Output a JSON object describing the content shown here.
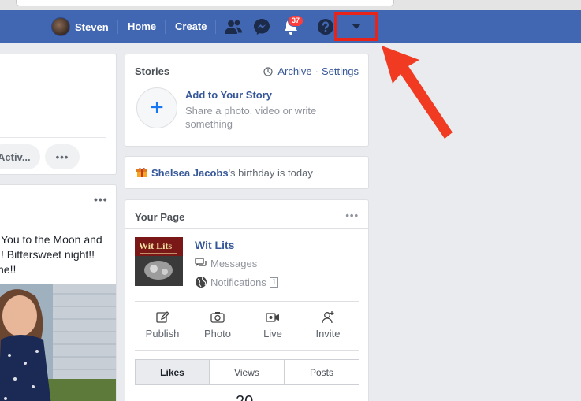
{
  "topbar": {
    "profile_name": "Steven",
    "home_label": "Home",
    "create_label": "Create",
    "notification_count": "37",
    "brand_color": "#4267b2",
    "highlight_color": "#e8241a",
    "icons": [
      "friend-requests-icon",
      "messenger-icon",
      "notifications-icon",
      "help-icon",
      "dropdown-caret-icon"
    ]
  },
  "left_column": {
    "activity_pill": "Activ...",
    "more_pill": "•••",
    "post_more": "•••",
    "post_lines": [
      "You to the Moon and",
      "! Bittersweet night!!",
      "ne!!"
    ]
  },
  "stories": {
    "title": "Stories",
    "archive_link": "Archive",
    "separator": "·",
    "settings_link": "Settings",
    "add_title": "Add to Your Story",
    "add_subtitle": "Share a photo, video or write something"
  },
  "birthday": {
    "name": "Shelsea Jacobs",
    "suffix": "'s birthday is today"
  },
  "your_page": {
    "title": "Your Page",
    "more": "•••",
    "page_name": "Wit Lits",
    "thumb_title": "Wit Lits",
    "messages_label": "Messages",
    "notifications_label": "Notifications",
    "notifications_count": "1",
    "actions": [
      {
        "label": "Publish",
        "icon": "pencil-icon"
      },
      {
        "label": "Photo",
        "icon": "camera-icon"
      },
      {
        "label": "Live",
        "icon": "video-icon"
      },
      {
        "label": "Invite",
        "icon": "add-person-icon"
      }
    ],
    "tabs": [
      "Likes",
      "Views",
      "Posts"
    ],
    "active_tab": "Likes",
    "likes_count": "20"
  }
}
